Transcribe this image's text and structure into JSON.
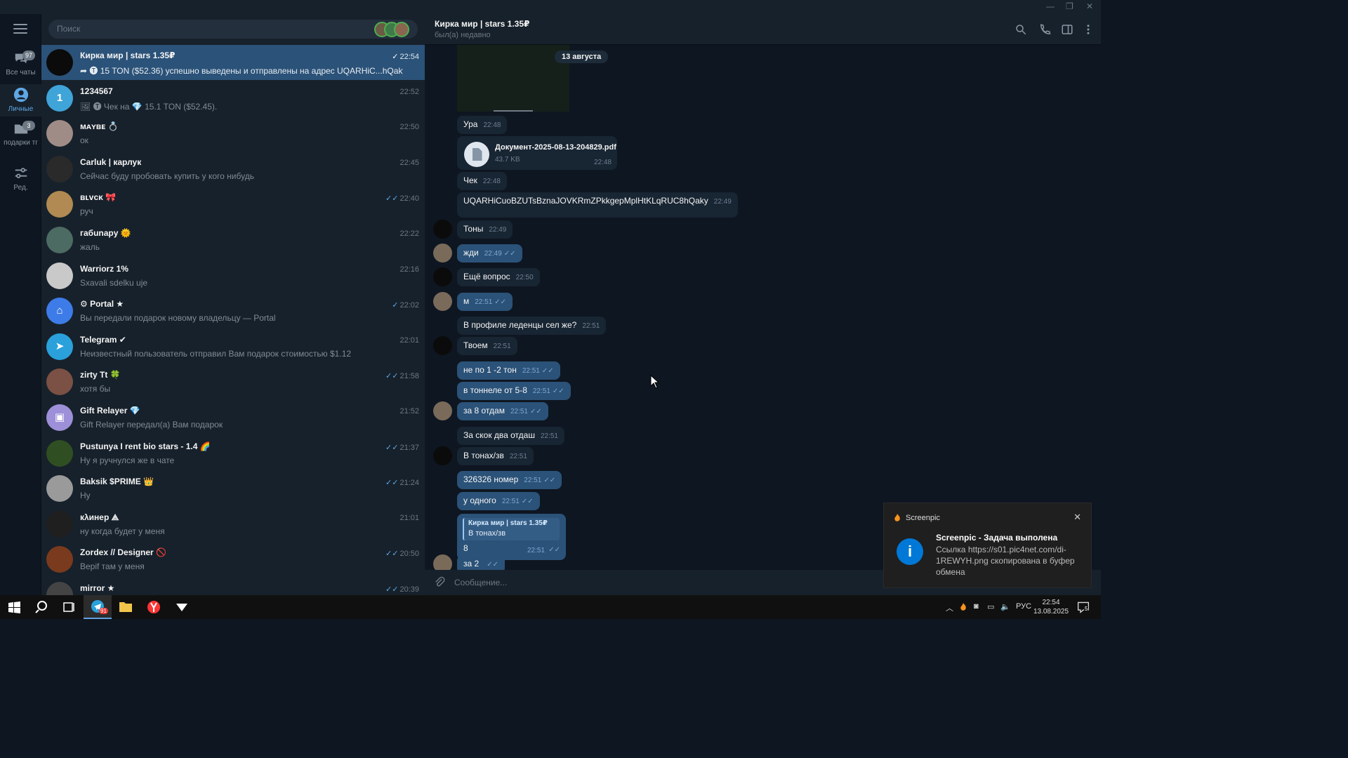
{
  "titlebar": {
    "minimize": "—",
    "restore": "❐",
    "close": "✕"
  },
  "rail": {
    "folders": [
      {
        "label": "Все чаты",
        "badge": "97"
      },
      {
        "label": "Личные",
        "badge": ""
      },
      {
        "label": "подарки тг",
        "badge": "3"
      },
      {
        "label": "Ред.",
        "badge": ""
      }
    ]
  },
  "search": {
    "placeholder": "Поиск"
  },
  "chats": [
    {
      "name": "Кирка мир | stars 1.35₽",
      "message": "➦ 🅣 15 TON ($52.36) успешно выведены и отправлены на адрес UQARHiC...hQaky.",
      "time": "22:54",
      "tick": "✓",
      "avatar_letter": "",
      "avatar_color": "#0b0b0b"
    },
    {
      "name": "1234567",
      "message": "🖼 🅣 Чек на 💎 15.1 TON ($52.45).",
      "time": "22:52",
      "tick": "",
      "avatar_letter": "1",
      "avatar_color": "#3fa4d8"
    },
    {
      "name": "ᴍᴀʏʙᴇ 💍",
      "message": "ок",
      "time": "22:50",
      "tick": "",
      "avatar_letter": "",
      "avatar_color": "#a08c86"
    },
    {
      "name": "Carluk | карлук",
      "message": "Сейчас буду пробовать купить у кого нибудь",
      "time": "22:45",
      "tick": "",
      "avatar_letter": "",
      "avatar_color": "#2a2a2a"
    },
    {
      "name": "ʙʟᴠᴄᴋ 🎀",
      "message": "руч",
      "time": "22:40",
      "tick": "✓✓",
      "avatar_letter": "",
      "avatar_color": "#b08a52"
    },
    {
      "name": "габunapy 🌞",
      "message": "жаль",
      "time": "22:22",
      "tick": "",
      "avatar_letter": "",
      "avatar_color": "#4c6b62"
    },
    {
      "name": "Warriorz 1%",
      "message": "Sxavali sdelku uje",
      "time": "22:16",
      "tick": "",
      "avatar_letter": "",
      "avatar_color": "#c9c9c9"
    },
    {
      "name": "⚙ Portal ★",
      "message": "Вы передали подарок новому владельцу — Portal",
      "time": "22:02",
      "tick": "✓",
      "avatar_letter": "⌂",
      "avatar_color": "#3d7ce8"
    },
    {
      "name": "Telegram ✔",
      "message": "Неизвестный пользователь отправил Вам подарок стоимостью $1.12",
      "time": "22:01",
      "tick": "",
      "avatar_letter": "➤",
      "avatar_color": "#2aa1db"
    },
    {
      "name": "zirty Tt 🍀",
      "message": "хотя бы",
      "time": "21:58",
      "tick": "✓✓",
      "avatar_letter": "",
      "avatar_color": "#7a5144"
    },
    {
      "name": "Gift Relayer 💎",
      "message": "Gift Relayer передал(а) Вам подарок",
      "time": "21:52",
      "tick": "",
      "avatar_letter": "▣",
      "avatar_color": "#9d8fd8"
    },
    {
      "name": "Pustunya I rent bio stars - 1.4 🌈",
      "message": "Ну я ручнулся же в чате",
      "time": "21:37",
      "tick": "✓✓",
      "avatar_letter": "",
      "avatar_color": "#2f4f22"
    },
    {
      "name": "Baksik $PRIME 👑",
      "message": "Ну",
      "time": "21:24",
      "tick": "✓✓",
      "avatar_letter": "",
      "avatar_color": "#9a9a9a"
    },
    {
      "name": "кλинер ⟁",
      "message": "ну когда будет у меня",
      "time": "21:01",
      "tick": "",
      "avatar_letter": "",
      "avatar_color": "#1f1f1f"
    },
    {
      "name": "Zordex // Designer 🚫",
      "message": "Верif там у меня",
      "time": "20:50",
      "tick": "✓✓",
      "avatar_letter": "",
      "avatar_color": "#7a3a1d"
    },
    {
      "name": "mirror ★",
      "message": "",
      "time": "20:39",
      "tick": "✓✓",
      "avatar_letter": "",
      "avatar_color": "#444"
    }
  ],
  "conversation": {
    "title": "Кирка мир | stars 1.35₽",
    "status": "был(а) недавно",
    "date": "13 августа",
    "doc": {
      "name": "Документ-2025-08-13-204829.pdf",
      "size": "43.7 KB",
      "time": "22:48"
    },
    "reply": {
      "author": "Кирка мир | stars 1.35₽",
      "quote": "В тонах/зв",
      "text": "8",
      "time": "22:51"
    },
    "messages": [
      {
        "text": "Ура",
        "time": "22:48",
        "out": false
      },
      {
        "text": "Чек",
        "time": "22:48",
        "out": false
      },
      {
        "text": "UQARHiCuoBZUTsBznaJOVKRmZPkkgepMplHtKLqRUC8hQaky",
        "time": "22:49",
        "out": false
      },
      {
        "text": "Тоны",
        "time": "22:49",
        "out": false
      },
      {
        "text": "жди",
        "time": "22:49",
        "out": true
      },
      {
        "text": "Ещё вопрос",
        "time": "22:50",
        "out": false
      },
      {
        "text": "м",
        "time": "22:51",
        "out": true
      },
      {
        "text": "В профиле леденцы сел же?",
        "time": "22:51",
        "out": false
      },
      {
        "text": "Твоем",
        "time": "22:51",
        "out": false
      },
      {
        "text": "не по 1 -2 тон",
        "time": "22:51",
        "out": true
      },
      {
        "text": "в тоннеле от 5-8",
        "time": "22:51",
        "out": true
      },
      {
        "text": "за 8 отдам",
        "time": "22:51",
        "out": true
      },
      {
        "text": "За скок два отдаш",
        "time": "22:51",
        "out": false
      },
      {
        "text": "В тонах/зв",
        "time": "22:51",
        "out": false
      },
      {
        "text": "326326 номер",
        "time": "22:51",
        "out": true
      },
      {
        "text": "у одного",
        "time": "22:51",
        "out": true
      },
      {
        "text": "за 2",
        "time": "",
        "out": true
      }
    ],
    "composer_placeholder": "Сообщение..."
  },
  "toast": {
    "app": "Screenpic",
    "title": "Screenpic - Задача выполена",
    "body": "Ссылка https://s01.pic4net.com/di-1REWYH.png скопирована в буфер обмена",
    "close": "✕"
  },
  "taskbar": {
    "lang": "РУС",
    "time": "22:54",
    "date": "13.08.2025",
    "notifications": "5",
    "telegram_badge": "91"
  }
}
